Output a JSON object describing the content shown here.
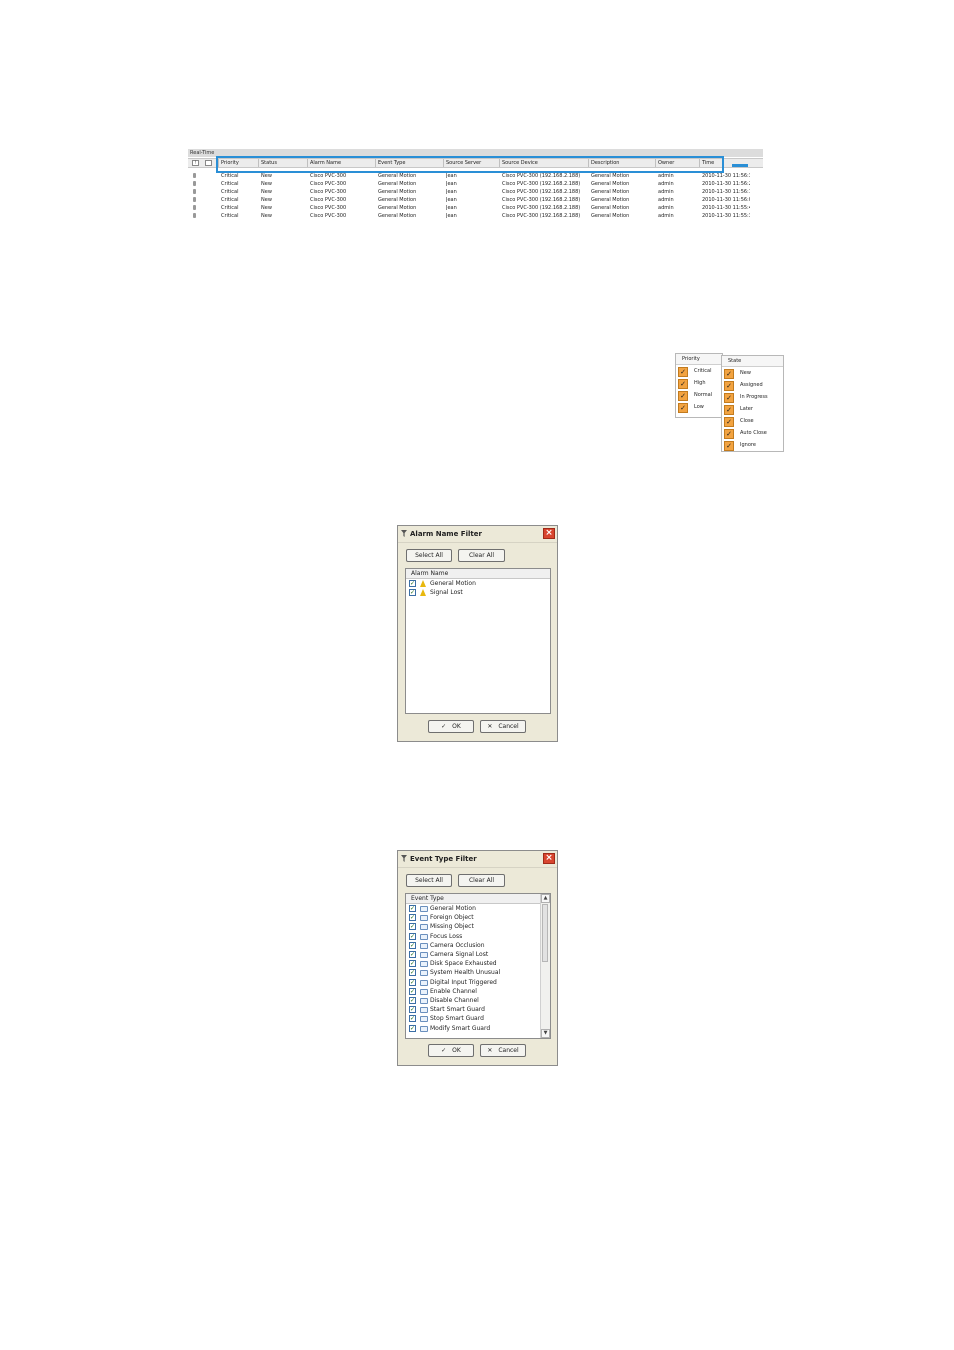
{
  "realtime": {
    "title": "Real-Time",
    "columns": [
      "Priority",
      "Status",
      "Alarm Name",
      "Event Type",
      "Source Server",
      "Source Device",
      "Description",
      "Owner",
      "Time"
    ],
    "rows": [
      [
        "Critical",
        "New",
        "Cisco PVC-300",
        "General Motion",
        "Jean",
        "Cisco PVC-300 (192.168.2.188)",
        "General Motion",
        "admin",
        "2010-11-30 11:56:33"
      ],
      [
        "Critical",
        "New",
        "Cisco PVC-300",
        "General Motion",
        "Jean",
        "Cisco PVC-300 (192.168.2.188)",
        "General Motion",
        "admin",
        "2010-11-30 11:56:23"
      ],
      [
        "Critical",
        "New",
        "Cisco PVC-300",
        "General Motion",
        "Jean",
        "Cisco PVC-300 (192.168.2.188)",
        "General Motion",
        "admin",
        "2010-11-30 11:56:12"
      ],
      [
        "Critical",
        "New",
        "Cisco PVC-300",
        "General Motion",
        "Jean",
        "Cisco PVC-300 (192.168.2.188)",
        "General Motion",
        "admin",
        "2010-11-30 11:56:01"
      ],
      [
        "Critical",
        "New",
        "Cisco PVC-300",
        "General Motion",
        "Jean",
        "Cisco PVC-300 (192.168.2.188)",
        "General Motion",
        "admin",
        "2010-11-30 11:55:48"
      ],
      [
        "Critical",
        "New",
        "Cisco PVC-300",
        "General Motion",
        "Jean",
        "Cisco PVC-300 (192.168.2.188)",
        "General Motion",
        "admin",
        "2010-11-30 11:55:38"
      ]
    ],
    "highlight_color": "#2a8fd6"
  },
  "priority_filter": {
    "header": "Priority",
    "items": [
      "Critical",
      "High",
      "Normal",
      "Low"
    ]
  },
  "state_filter": {
    "header": "State",
    "items": [
      "New",
      "Assigned",
      "In Progress",
      "Later",
      "Close",
      "Auto Close",
      "Ignore"
    ]
  },
  "alarm_name_filter": {
    "title": "Alarm Name Filter",
    "select_all": "Select All",
    "clear_all": "Clear All",
    "column": "Alarm Name",
    "items": [
      "General Motion",
      "Signal Lost"
    ],
    "ok": "OK",
    "cancel": "Cancel"
  },
  "event_type_filter": {
    "title": "Event Type Filter",
    "select_all": "Select All",
    "clear_all": "Clear All",
    "column": "Event Type",
    "items": [
      "General Motion",
      "Foreign Object",
      "Missing Object",
      "Focus Loss",
      "Camera Occlusion",
      "Camera Signal Lost",
      "Disk Space Exhausted",
      "System Health Unusual",
      "Digital Input Triggered",
      "Enable Channel",
      "Disable Channel",
      "Start Smart Guard",
      "Stop Smart Guard",
      "Modify Smart Guard"
    ],
    "ok": "OK",
    "cancel": "Cancel"
  },
  "colors": {
    "checkbox_orange": "#f2a341",
    "dialog_bg": "#ece9d8",
    "close_red": "#d8452f"
  }
}
